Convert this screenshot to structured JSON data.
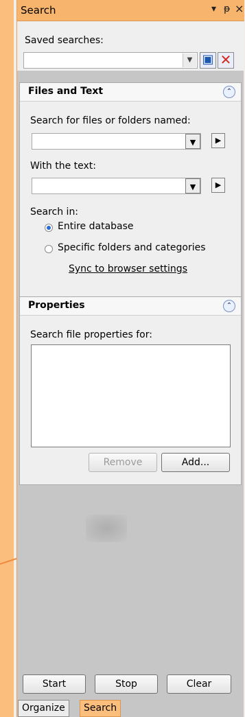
{
  "window": {
    "title": "Search",
    "controls": [
      "▾",
      "ᵽ",
      "×"
    ]
  },
  "saved_searches": {
    "label": "Saved searches:",
    "value": ""
  },
  "files_and_text": {
    "title": "Files and Text",
    "named_label": "Search for files or folders named:",
    "named_value": "",
    "text_label": "With the text:",
    "text_value": "",
    "search_in_label": "Search in:",
    "options": [
      "Entire database",
      "Specific folders and categories"
    ],
    "selected": "Entire database",
    "sync_link": "Sync to browser settings"
  },
  "properties": {
    "title": "Properties",
    "label": "Search file properties for:",
    "remove_label": "Remove",
    "add_label": "Add..."
  },
  "actions": {
    "start": "Start",
    "stop": "Stop",
    "clear": "Clear"
  },
  "tabs": [
    {
      "label": "Organize",
      "active": false
    },
    {
      "label": "Search",
      "active": true
    }
  ],
  "colors": {
    "accent": "#fbbe7d",
    "panel": "#c6c6c6",
    "group": "#efefef"
  }
}
